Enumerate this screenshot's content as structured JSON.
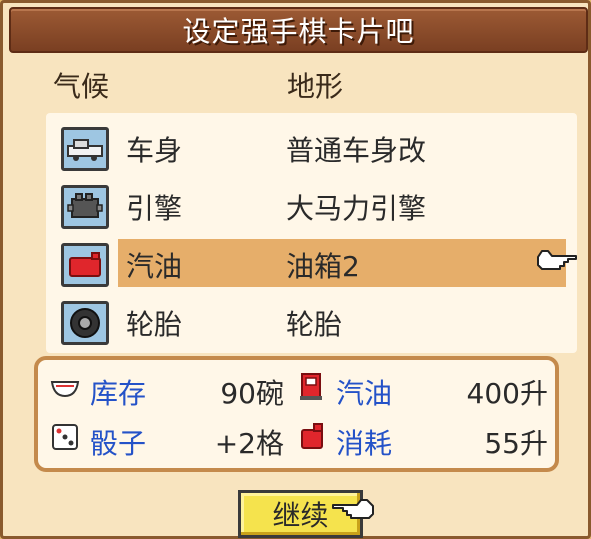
{
  "title": "设定强手棋卡片吧",
  "headers": {
    "left": "气候",
    "right": "地形"
  },
  "parts": [
    {
      "label": "车身",
      "value": "普通车身改",
      "icon": "car-body-icon"
    },
    {
      "label": "引擎",
      "value": "大马力引擎",
      "icon": "engine-icon"
    },
    {
      "label": "汽油",
      "value": "油箱2",
      "icon": "fuel-tank-icon",
      "selected": true
    },
    {
      "label": "轮胎",
      "value": "轮胎",
      "icon": "tire-icon"
    }
  ],
  "stats": {
    "stock": {
      "label": "库存",
      "value": "90碗",
      "icon": "bowl-icon"
    },
    "fuel": {
      "label": "汽油",
      "value": "400升",
      "icon": "fuel-pump-icon"
    },
    "dice": {
      "label": "骰子",
      "value": "+2格",
      "icon": "dice-icon"
    },
    "consumption": {
      "label": "消耗",
      "value": "55升",
      "icon": "fuel-can-icon"
    }
  },
  "continue_label": "继续",
  "colors": {
    "title_bar": "#8a4a2a",
    "selection": "#e6ae6a",
    "stat_label": "#2452c8",
    "button": "#f5e34d"
  }
}
